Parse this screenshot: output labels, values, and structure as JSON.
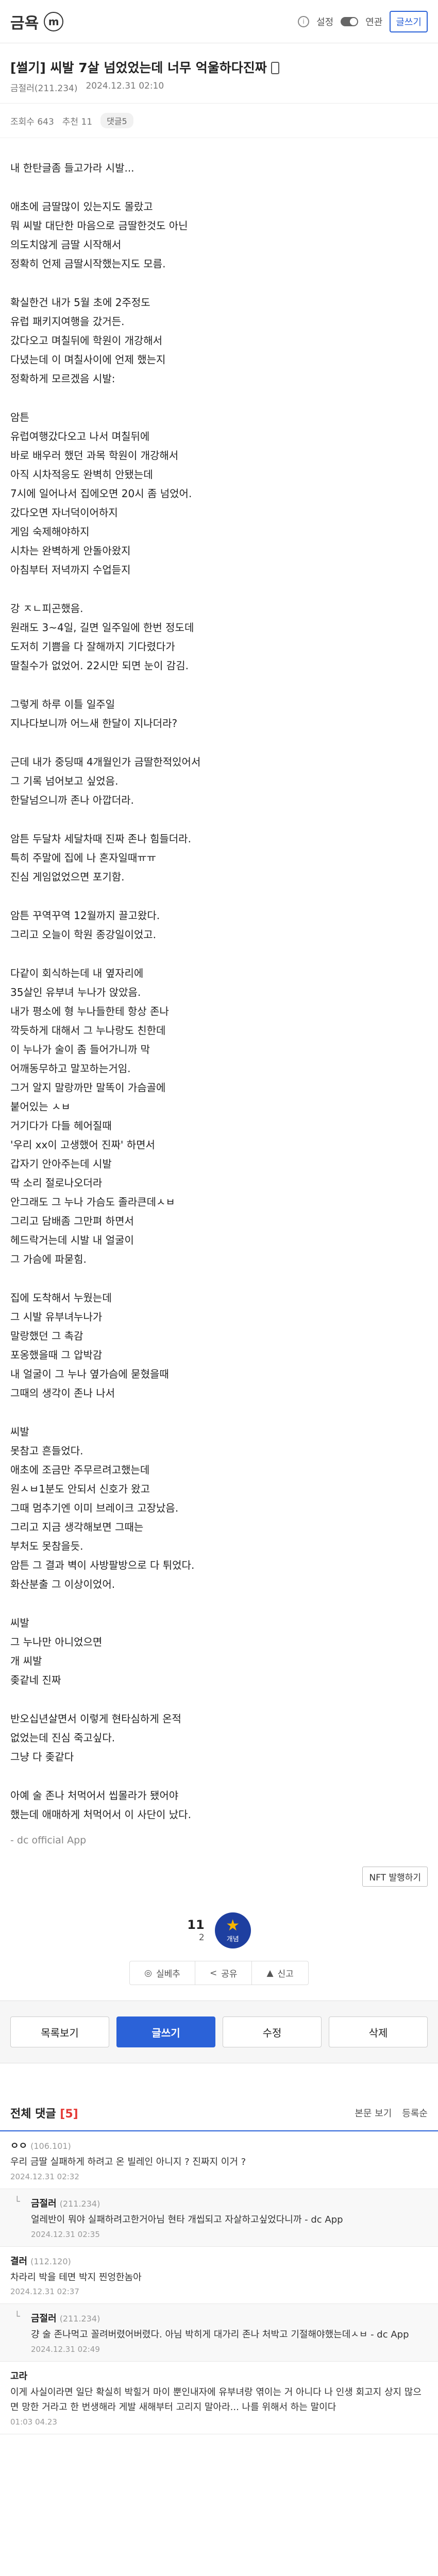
{
  "topbar": {
    "brand": "금욕",
    "gallery_badge": "m",
    "settings_label": "설정",
    "login_label": "연관",
    "write_label": "글쓰기"
  },
  "post": {
    "title": "[썰기] 씨발 7살 넘었었는데 너무 억울하다진짜",
    "author": "금절러(211.234)",
    "date": "2024.12.31 02:10",
    "views": "조회수 643",
    "recommends": "추천 11",
    "comment_pill": "댓글5"
  },
  "body_paragraphs": [
    [
      "내 한탄글좀 들고가라 시발..."
    ],
    [
      "애초에 금딸많이 있는지도 몰랐고",
      "뭐 씨발 대단한 마음으로 금딸한것도 아닌",
      "의도치않게 금딸 시작해서",
      "정확히 언제 금딸시작했는지도 모름."
    ],
    [
      "확실한건 내가 5월 초에 2주정도",
      "유럽 패키지여행을 갔거든.",
      "갔다오고 며칠뒤에 학원이 개강해서",
      "다녔는데 이 며칠사이에 언제 했는지",
      "정확하게 모르겠음 시발:"
    ],
    [
      "암튼",
      "유럽여행갔다오고 나서 며칠뒤에",
      "바로 배우러 했던 과목 학원이 개강해서",
      "아직 시차적응도 완벽히 안됐는데",
      "7시에 일어나서 집에오면 20시 좀 넘었어.",
      "갔다오면 자너덕이어하지",
      "게임 숙제해야하지",
      "시차는 완벽하게 안돌아왔지",
      "아침부터 저녁까지 수업듣지"
    ],
    [
      "강 ㅈㄴ피곤했음.",
      "원래도 3~4일, 길면 일주일에 한번 정도데",
      "도저히 기쁨을 다 잘해까지 기다렸다가",
      "딸칠수가 없었어. 22시만 되면 눈이 감김."
    ],
    [
      "그렇게 하루 이틀 일주일",
      "지나다보니까 어느새 한달이 지나더라?"
    ],
    [
      "근데 내가 중딩때 4개월인가 금딸한적있어서",
      "그 기록 넘어보고 싶었음.",
      "한달넘으니까 존나 아깝더라."
    ],
    [
      "암튼 두달차 세달차때 진짜 존나 힘들더라.",
      "특히 주말에 집에 나 혼자일때ㅠㅠ",
      "진심 게임없었으면 포기함."
    ],
    [
      "암튼 꾸역꾸역 12월까지 끌고왔다.",
      "그리고 오늘이 학원 종강일이었고."
    ],
    [
      "다같이 회식하는데 내 옆자리에",
      "35살인 유부녀 누나가 앉았음.",
      "내가 평소에 형 누나들한테 항상 존나",
      "깍듯하게 대해서 그 누나랑도 친한데",
      "이 누나가 술이 좀 들어가니까 막",
      "어깨동무하고 말꼬하는거임.",
      "그거 알지 말랑까만 말똑이 가슴골에",
      "붙어있는 ㅅㅂ",
      "거기다가 다들 헤어질때",
      "'우리 xx이 고생했어 진짜' 하면서",
      "갑자기 안아주는데 시발",
      "딱 소리 절로나오더라",
      "안그래도 그 누나 가슴도 졸라큰데ㅅㅂ",
      "그리고 담배좀 그만펴 하면서",
      "헤드락거는데 시발 내 얼굴이",
      "그 가슴에 파묻힘."
    ],
    [
      "집에 도착해서 누웠는데",
      "그 시발 유부녀누나가",
      "말랑했던 그 촉감",
      "포옹했을때 그 압박감",
      "내 얼굴이 그 누나 옆가슴에 묻혔을때",
      "그때의 생각이 존나 나서"
    ],
    [
      "씨발",
      "못참고 흔들었다.",
      "애초에 조금만 주무르려고했는데",
      "원ㅅㅂ1분도 안되서 신호가 왔고",
      "그때 멈추기엔 이미 브레이크 고장났음.",
      "그리고 지금 생각해보면 그때는",
      "부처도 못참을듯.",
      "암튼 그 결과 벽이 사방팔방으로 다 튀었다.",
      "화산분출 그 이상이었어."
    ],
    [
      "씨발",
      "그 누나만 아니었으면",
      "개 씨발",
      "좆같네 진짜"
    ],
    [
      "반오십년살면서 이렇게 현타심하게 온적",
      "없었는데 진심 죽고싶다.",
      "그냥 다 좆같다"
    ],
    [
      "아예 술 존나 처먹어서 씹몰라가 됐어야",
      "했는데 애매하게 처먹어서 이 사단이 났다."
    ]
  ],
  "source_text": "- dc official App",
  "nft_label": "NFT 발행하기",
  "recommend": {
    "count": "11",
    "fixed": "2",
    "button_label": "개념",
    "star_glyph": "★"
  },
  "share": {
    "items": [
      "실베추",
      "공유",
      "신고"
    ]
  },
  "actions": [
    "목록보기",
    "글쓰기",
    "수정",
    "삭제"
  ],
  "comments": {
    "title": "전체 댓글",
    "count": "[5]",
    "sort_labels": [
      "본문 보기",
      "등록순"
    ],
    "items": [
      {
        "nick": "ㅇㅇ",
        "ip": "(106.101)",
        "text": "우리 금딸 실패하게 하려고 온 빌레인 아니지 ? 진짜지 이거 ?",
        "date": "2024.12.31 02:32",
        "reply": false
      },
      {
        "nick": "금절러",
        "ip": "(211.234)",
        "text": "얼레반이 뭐야 실패하려고한거아님 현타 개씹되고 자살하고싶었다니까 - dc App",
        "date": "2024.12.31 02:35",
        "reply": true
      },
      {
        "nick": "결러",
        "ip": "(112.120)",
        "text": "차라리 박을 테면 박지 찐엉한놈아",
        "date": "2024.12.31 02:37",
        "reply": false
      },
      {
        "nick": "금절러",
        "ip": "(211.234)",
        "text": "걍 술 존나먹고 꼴려버렸어버렸다. 아님 박히게 대가리 존나 처박고 기절해야했는데ㅅㅂ - dc App",
        "date": "2024.12.31 02:49",
        "reply": true
      },
      {
        "nick": "고라",
        "ip": "",
        "text": "이게 사실이라면 일단 확실히 박힐거 마이 뿐인내자에 유부녀랑 엮이는 거 아니다 나 인생 회고지 상지 많으면 망한 거라고 한 번생해라 게발 새해부터 고리지 말아라... 나를 위해서 하는 말이다",
        "date": "01:03 04.23",
        "reply": false
      }
    ]
  }
}
